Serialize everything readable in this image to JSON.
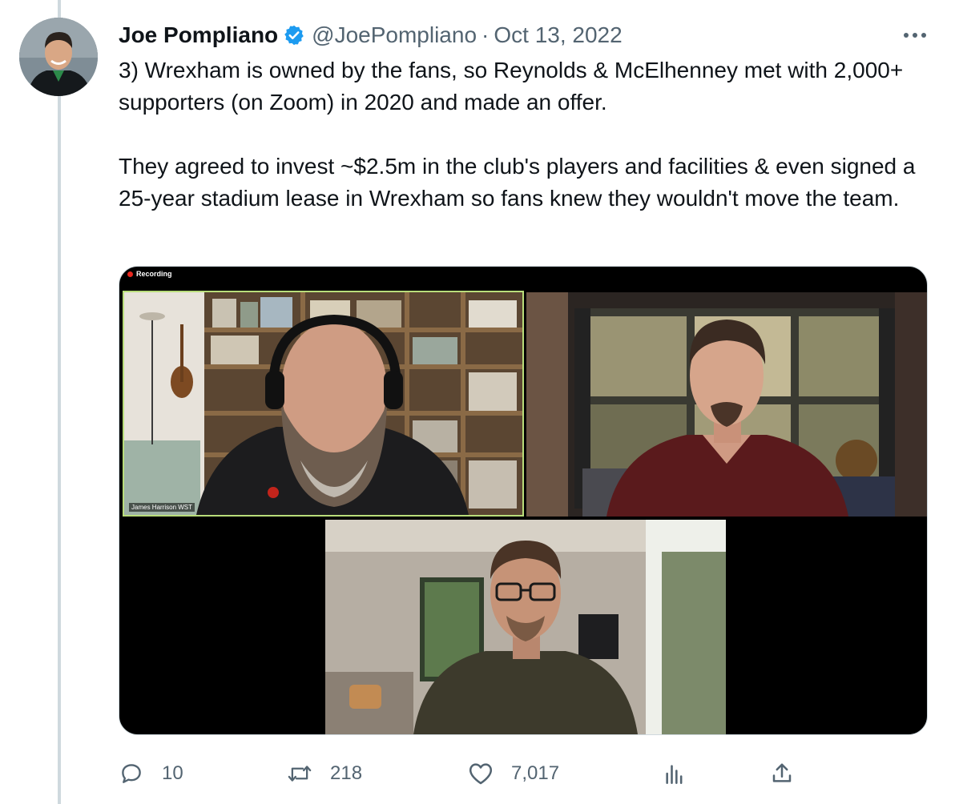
{
  "author": {
    "name": "Joe Pompliano",
    "handle": "@JoePompliano",
    "separator": "·",
    "date": "Oct 13, 2022",
    "verified_color": "#1d9bf0"
  },
  "tweet": {
    "paragraph_1": "3) Wrexham is owned by the fans, so Reynolds & McElhenney met with 2,000+ supporters (on Zoom) in 2020 and made an offer.",
    "paragraph_2": "They agreed to invest ~$2.5m in the club's players and facilities & even signed a 25-year stadium lease in Wrexham so fans knew they wouldn't move the team."
  },
  "media": {
    "recording_label": "Recording",
    "participant_label": "James Harrison WST"
  },
  "actions": {
    "reply_count": "10",
    "retweet_count": "218",
    "like_count": "7,017"
  },
  "icons": {
    "more": "more-icon",
    "reply": "reply-icon",
    "retweet": "retweet-icon",
    "like": "heart-icon",
    "views": "views-icon",
    "share": "share-icon",
    "verified": "verified-badge-icon"
  },
  "colors": {
    "text_primary": "#0f1419",
    "text_secondary": "#536471",
    "thread_line": "#cfd9de",
    "active_speaker_border": "#b9dd7a"
  }
}
